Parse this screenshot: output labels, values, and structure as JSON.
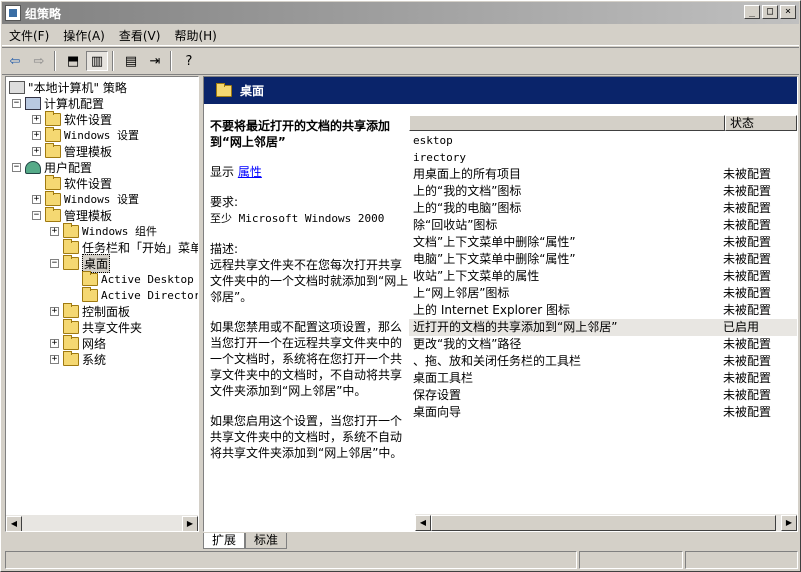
{
  "window": {
    "title": "组策略"
  },
  "menu": [
    "文件(F)",
    "操作(A)",
    "查看(V)",
    "帮助(H)"
  ],
  "tree": {
    "root": "\"本地计算机\" 策略",
    "computer": "计算机配置",
    "computer_children": [
      "软件设置",
      "Windows 设置",
      "管理模板"
    ],
    "user": "用户配置",
    "user_children": [
      "软件设置",
      "Windows 设置",
      "管理模板"
    ],
    "admin_children": [
      "Windows 组件",
      "任务栏和「开始」菜单",
      "桌面",
      "控制面板",
      "共享文件夹",
      "网络",
      "系统"
    ],
    "desktop_children": [
      "Active Desktop",
      "Active Directory"
    ]
  },
  "header": {
    "title": "桌面"
  },
  "extended": {
    "setting_title": "不要将最近打开的文档的共享添加到“网上邻居”",
    "display_prefix": "显示",
    "display_link": "属性",
    "req_label": "要求:",
    "req_value": "至少 Microsoft Windows 2000",
    "desc_label": "描述:",
    "desc1": "远程共享文件夹不在您每次打开共享文件夹中的一个文档时就添加到“网上邻居”。",
    "desc2": "如果您禁用或不配置这项设置，那么当您打开一个在远程共享文件夹中的一个文档时，系统将在您打开一个共享文件夹中的文档时，不自动将共享文件夹添加到“网上邻居”中。",
    "desc3": "如果您启用这个设置，当您打开一个共享文件夹中的文档时，系统不自动将共享文件夹添加到“网上邻居”中。"
  },
  "list": {
    "col_state": "状态",
    "rows": [
      {
        "name": "esktop",
        "state": ""
      },
      {
        "name": "irectory",
        "state": ""
      },
      {
        "name": "用桌面上的所有项目",
        "state": "未被配置"
      },
      {
        "name": "上的“我的文档”图标",
        "state": "未被配置"
      },
      {
        "name": "上的“我的电脑”图标",
        "state": "未被配置"
      },
      {
        "name": "除“回收站”图标",
        "state": "未被配置"
      },
      {
        "name": "文档”上下文菜单中删除“属性”",
        "state": "未被配置"
      },
      {
        "name": "电脑”上下文菜单中删除“属性”",
        "state": "未被配置"
      },
      {
        "name": "收站”上下文菜单的属性",
        "state": "未被配置"
      },
      {
        "name": "上“网上邻居”图标",
        "state": "未被配置"
      },
      {
        "name": "上的 Internet Explorer 图标",
        "state": "未被配置"
      },
      {
        "name": "近打开的文档的共享添加到“网上邻居”",
        "state": "已启用"
      },
      {
        "name": "更改“我的文档”路径",
        "state": "未被配置"
      },
      {
        "name": "、拖、放和关闭任务栏的工具栏",
        "state": "未被配置"
      },
      {
        "name": "桌面工具栏",
        "state": "未被配置"
      },
      {
        "name": "保存设置",
        "state": "未被配置"
      },
      {
        "name": "桌面向导",
        "state": "未被配置"
      }
    ]
  },
  "tabs": [
    "扩展",
    "标准"
  ]
}
